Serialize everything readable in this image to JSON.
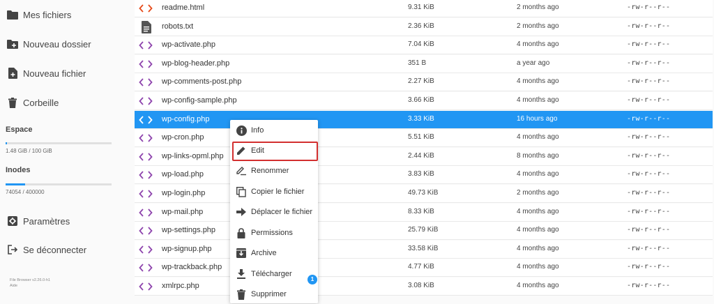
{
  "sidebar": {
    "items": [
      {
        "label": "Mes fichiers",
        "icon": "folder-icon"
      },
      {
        "label": "Nouveau dossier",
        "icon": "new-folder-icon"
      },
      {
        "label": "Nouveau fichier",
        "icon": "new-file-icon"
      },
      {
        "label": "Corbeille",
        "icon": "trash-icon"
      }
    ],
    "space": {
      "title": "Espace",
      "usage": "1.48 GiB / 100 GiB",
      "fraction": 0.0148
    },
    "inodes": {
      "title": "Inodes",
      "usage": "74054 / 400000",
      "fraction": 0.185
    },
    "settings_label": "Paramètres",
    "logout_label": "Se déconnecter",
    "version": "File Browser v2.26.0-h1",
    "help": "Aide"
  },
  "files": [
    {
      "name": "readme.html",
      "size": "9.31 KiB",
      "date": "2 months ago",
      "perm": "-rw-r--r--",
      "icon": "code-icon"
    },
    {
      "name": "robots.txt",
      "size": "2.36 KiB",
      "date": "2 months ago",
      "perm": "-rw-r--r--",
      "icon": "text-file-icon"
    },
    {
      "name": "wp-activate.php",
      "size": "7.04 KiB",
      "date": "4 months ago",
      "perm": "-rw-r--r--",
      "icon": "code-icon"
    },
    {
      "name": "wp-blog-header.php",
      "size": "351 B",
      "date": "a year ago",
      "perm": "-rw-r--r--",
      "icon": "code-icon"
    },
    {
      "name": "wp-comments-post.php",
      "size": "2.27 KiB",
      "date": "4 months ago",
      "perm": "-rw-r--r--",
      "icon": "code-icon"
    },
    {
      "name": "wp-config-sample.php",
      "size": "3.66 KiB",
      "date": "4 months ago",
      "perm": "-rw-r--r--",
      "icon": "code-icon"
    },
    {
      "name": "wp-config.php",
      "size": "3.33 KiB",
      "date": "16 hours ago",
      "perm": "-rw-r--r--",
      "icon": "code-icon",
      "selected": true
    },
    {
      "name": "wp-cron.php",
      "size": "5.51 KiB",
      "date": "4 months ago",
      "perm": "-rw-r--r--",
      "icon": "code-icon"
    },
    {
      "name": "wp-links-opml.php",
      "size": "2.44 KiB",
      "date": "8 months ago",
      "perm": "-rw-r--r--",
      "icon": "code-icon"
    },
    {
      "name": "wp-load.php",
      "size": "3.83 KiB",
      "date": "4 months ago",
      "perm": "-rw-r--r--",
      "icon": "code-icon"
    },
    {
      "name": "wp-login.php",
      "size": "49.73 KiB",
      "date": "2 months ago",
      "perm": "-rw-r--r--",
      "icon": "code-icon"
    },
    {
      "name": "wp-mail.php",
      "size": "8.33 KiB",
      "date": "4 months ago",
      "perm": "-rw-r--r--",
      "icon": "code-icon"
    },
    {
      "name": "wp-settings.php",
      "size": "25.79 KiB",
      "date": "4 months ago",
      "perm": "-rw-r--r--",
      "icon": "code-icon"
    },
    {
      "name": "wp-signup.php",
      "size": "33.58 KiB",
      "date": "4 months ago",
      "perm": "-rw-r--r--",
      "icon": "code-icon"
    },
    {
      "name": "wp-trackback.php",
      "size": "4.77 KiB",
      "date": "4 months ago",
      "perm": "-rw-r--r--",
      "icon": "code-icon"
    },
    {
      "name": "xmlrpc.php",
      "size": "3.08 KiB",
      "date": "4 months ago",
      "perm": "-rw-r--r--",
      "icon": "code-icon"
    }
  ],
  "context_menu": {
    "items": [
      {
        "label": "Info",
        "icon": "info-icon"
      },
      {
        "label": "Edit",
        "icon": "pencil-icon"
      },
      {
        "label": "Renommer",
        "icon": "rename-icon"
      },
      {
        "label": "Copier le fichier",
        "icon": "copy-icon"
      },
      {
        "label": "Déplacer le fichier",
        "icon": "move-arrow-icon"
      },
      {
        "label": "Permissions",
        "icon": "lock-icon"
      },
      {
        "label": "Archive",
        "icon": "archive-icon"
      },
      {
        "label": "Télécharger",
        "icon": "download-icon"
      },
      {
        "label": "Supprimer",
        "icon": "delete-icon"
      }
    ],
    "highlighted": "Edit",
    "badge": "1"
  },
  "colors": {
    "accent": "#2196f3",
    "code_icon": "#8e44ad",
    "highlight_border": "#d32f2f"
  }
}
